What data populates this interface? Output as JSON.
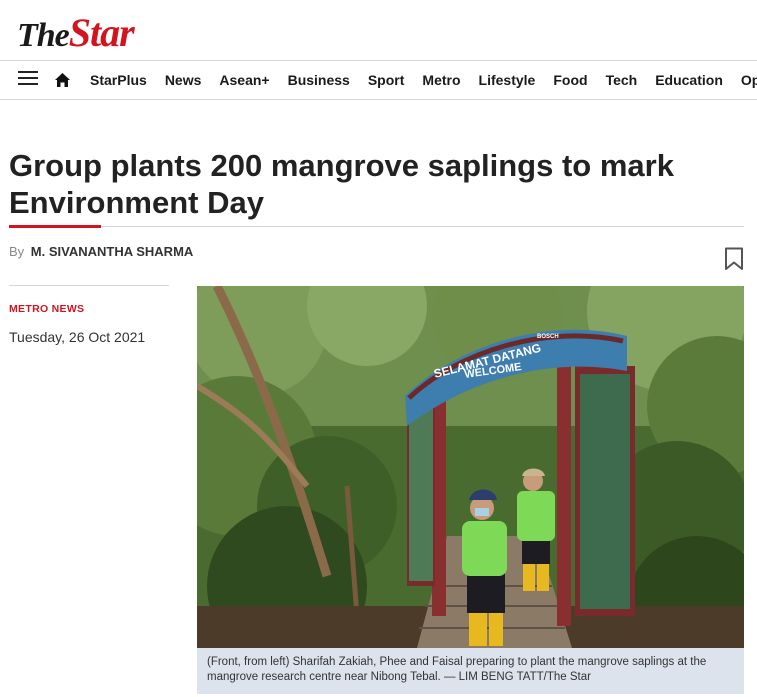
{
  "brand": {
    "logo_the": "The",
    "logo_star": "Star"
  },
  "nav": {
    "items": [
      "StarPlus",
      "News",
      "Asean+",
      "Business",
      "Sport",
      "Metro",
      "Lifestyle",
      "Food",
      "Tech",
      "Education",
      "Opinion"
    ]
  },
  "article": {
    "headline": "Group plants 200 mangrove saplings to mark Environment Day",
    "byline_prefix": "By",
    "author": "M. SIVANANTHA SHARMA",
    "category": "METRO NEWS",
    "date": "Tuesday, 26 Oct 2021"
  },
  "photo": {
    "arch_sign_top": "SELAMAT DATANG",
    "arch_sign_bottom": "WELCOME",
    "arch_sponsor": "BOSCH",
    "caption": "(Front, from left) Sharifah Zakiah, Phee and Faisal preparing to plant the mangrove saplings at the mangrove research centre near Nibong Tebal. — LIM BENG TATT/The Star"
  },
  "colors": {
    "brand_red": "#d3141f",
    "caption_bg": "#dde3ec",
    "rule": "#d8d8d8"
  },
  "icons": {
    "menu": "hamburger-icon",
    "home": "home-icon",
    "bookmark": "bookmark-icon"
  }
}
